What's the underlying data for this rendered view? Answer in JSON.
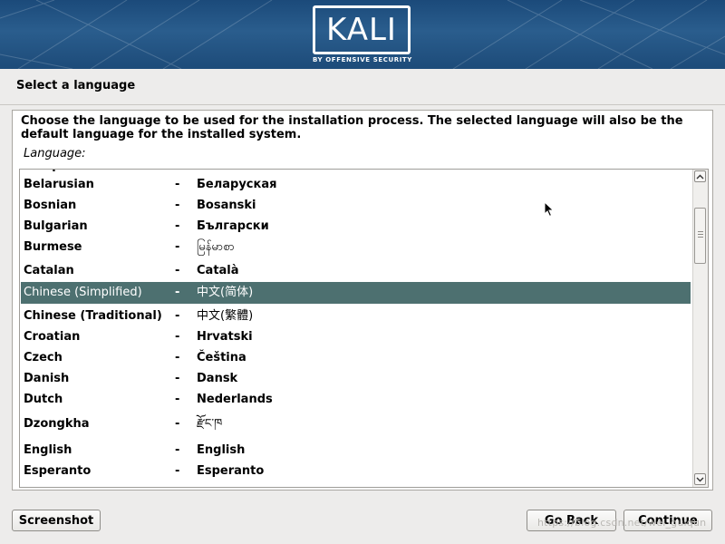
{
  "brand": {
    "logo_text": "KALI",
    "logo_subtitle": "BY OFFENSIVE SECURITY",
    "banner_color": "#1d4b79"
  },
  "step_title": "Select a language",
  "description": "Choose the language to be used for the installation process. The selected language will also be the default language for the installed system.",
  "language_caption": "Language:",
  "separator": "-",
  "languages": [
    {
      "name": "Belarusian",
      "native": "Беларуская"
    },
    {
      "name": "Bosnian",
      "native": "Bosanski"
    },
    {
      "name": "Bulgarian",
      "native": "Български"
    },
    {
      "name": "Burmese",
      "native": "မြန်မာစာ"
    },
    {
      "name": "Catalan",
      "native": "Català"
    },
    {
      "name": "Chinese (Simplified)",
      "native": "中文(简体)"
    },
    {
      "name": "Chinese (Traditional)",
      "native": "中文(繁體)"
    },
    {
      "name": "Croatian",
      "native": "Hrvatski"
    },
    {
      "name": "Czech",
      "native": "Čeština"
    },
    {
      "name": "Danish",
      "native": "Dansk"
    },
    {
      "name": "Dutch",
      "native": "Nederlands"
    },
    {
      "name": "Dzongkha",
      "native": "རྫོང་ཁ"
    },
    {
      "name": "English",
      "native": "English"
    },
    {
      "name": "Esperanto",
      "native": "Esperanto"
    }
  ],
  "selected_language": "Chinese (Simplified)",
  "selection_color": "#4d7070",
  "buttons": {
    "screenshot": "Screenshot",
    "go_back": "Go Back",
    "continue": "Continue"
  },
  "watermark": "https://blog.csdn.net/wei_guiqun"
}
